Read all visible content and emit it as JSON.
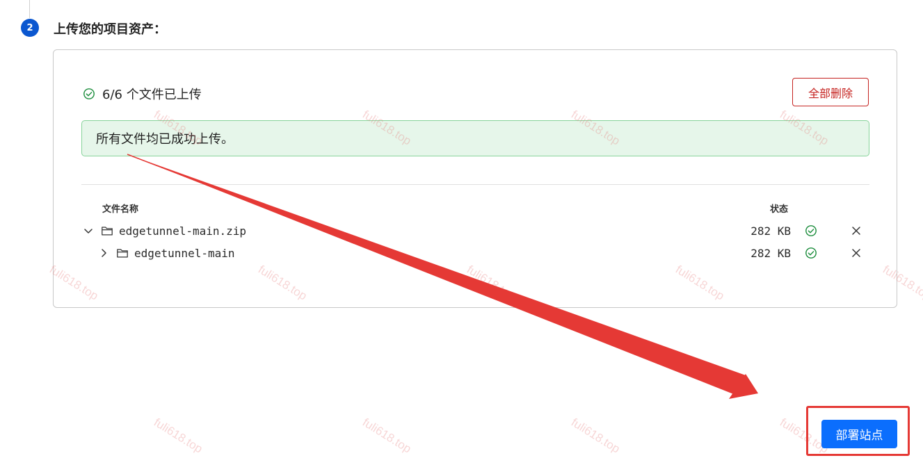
{
  "step": {
    "number": "2",
    "title": "上传您的项目资产："
  },
  "upload": {
    "status_text": "6/6 个文件已上传",
    "delete_all_label": "全部删除",
    "success_message": "所有文件均已成功上传。",
    "columns": {
      "name": "文件名称",
      "status": "状态"
    },
    "files": [
      {
        "name": "edgetunnel-main.zip",
        "size": "282 KB",
        "expand_icon": "chevron-down-icon",
        "status_icon": "check-circle-icon"
      },
      {
        "name": "edgetunnel-main",
        "size": "282 KB",
        "expand_icon": "chevron-right-icon",
        "status_icon": "check-circle-icon"
      }
    ]
  },
  "footer": {
    "deploy_label": "部署站点"
  },
  "annotation": {
    "arrow_color": "#e53935",
    "highlight_color": "#e53935"
  },
  "watermark": {
    "text": "fuli618.top"
  },
  "colors": {
    "accent": "#0b57d0",
    "primary_button": "#0b6efd",
    "danger": "#c5221f",
    "success": "#1e8e3e",
    "success_bg": "#e6f6ea"
  }
}
